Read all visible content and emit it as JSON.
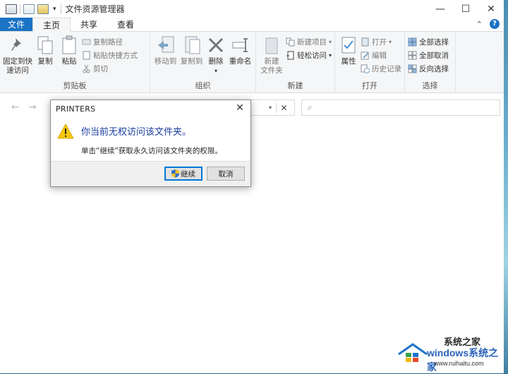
{
  "window": {
    "title": "文件资源管理器",
    "controls": {
      "minimize": "—",
      "maximize": "☐",
      "close": "✕"
    }
  },
  "tabs": [
    {
      "label": "文件"
    },
    {
      "label": "主页"
    },
    {
      "label": "共享"
    },
    {
      "label": "查看"
    }
  ],
  "ribbon": {
    "clipboard": {
      "label": "剪贴板",
      "pin": "固定到快\n速访问",
      "pin_line1": "固定到快",
      "pin_line2": "速访问",
      "copy": "复制",
      "paste": "粘贴",
      "copy_path": "复制路径",
      "paste_shortcut": "粘贴快捷方式",
      "cut": "剪切"
    },
    "organize": {
      "label": "组织",
      "move_to": "移动到",
      "copy_to": "复制到",
      "delete": "删除",
      "rename": "重命名"
    },
    "new": {
      "label": "新建",
      "new_item": "新建项目",
      "easy_access": "轻松访问",
      "new_folder_line1": "新建",
      "new_folder_line2": "文件夹"
    },
    "open": {
      "label": "打开",
      "properties": "属性",
      "open": "打开",
      "edit": "编辑",
      "history": "历史记录"
    },
    "select": {
      "label": "选择",
      "select_all": "全部选择",
      "select_none": "全部取消",
      "invert": "反向选择"
    }
  },
  "dialog": {
    "title": "PRINTERS",
    "message": "你当前无权访问该文件夹。",
    "detail": "单击“继续”获取永久访问该文件夹的权限。",
    "continue_label": "继续",
    "cancel_label": "取消"
  },
  "watermark": {
    "brand": "windows系统之家",
    "url": "www.ruihaitu.com",
    "top": "系统之家"
  }
}
